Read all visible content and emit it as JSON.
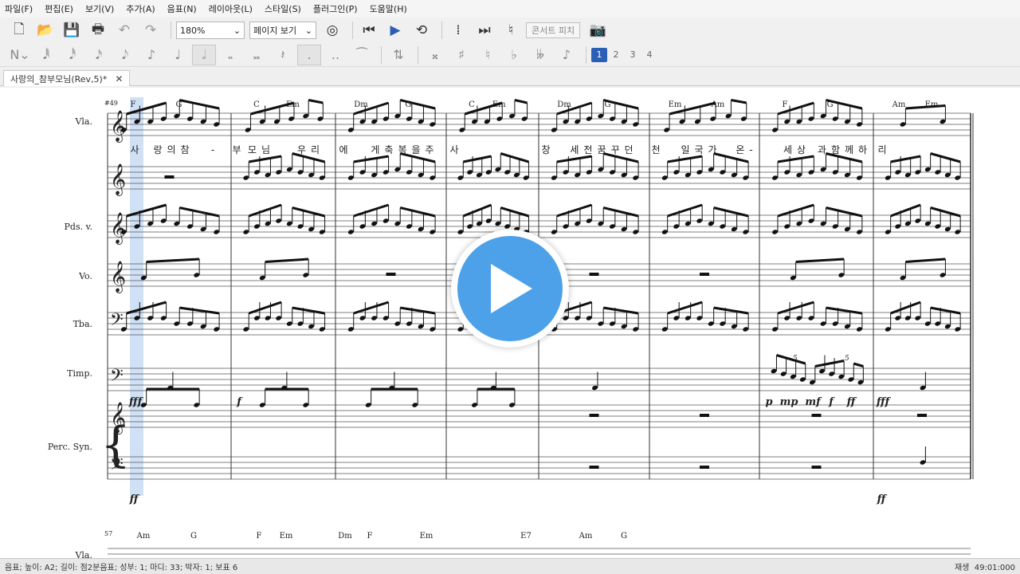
{
  "menu": [
    "파일(F)",
    "편집(E)",
    "보기(V)",
    "추가(A)",
    "음표(N)",
    "레이아웃(L)",
    "스타일(S)",
    "플러그인(P)",
    "도움말(H)"
  ],
  "toolbar": {
    "zoom": "180%",
    "view_mode": "페이지 보기",
    "concert_pitch": "콘서트 피치",
    "icons": [
      "new-score-icon",
      "open-icon",
      "save-icon",
      "print-icon",
      "undo-icon",
      "redo-icon",
      "midi-input-icon",
      "rewind-icon",
      "play-icon",
      "loop-icon",
      "play-repeats-icon",
      "pan-icon",
      "metronome-icon",
      "image-capture-icon"
    ]
  },
  "note_input": {
    "note_values": [
      "𝅘𝅥𝅱",
      "𝅘𝅥𝅰",
      "𝅘𝅥𝅯",
      "𝅘𝅥𝅮",
      "♪",
      "♩",
      "𝅗𝅥",
      "𝅝",
      "𝅜",
      "𝄽"
    ],
    "accidentals": [
      "𝄪",
      "♯",
      "♮",
      "♭",
      "𝄫"
    ],
    "voices": [
      "1",
      "2",
      "3",
      "4"
    ],
    "active_voice": "1"
  },
  "tab": {
    "title": "사랑의_참부모님(Rev,5)*"
  },
  "score": {
    "system1": {
      "measure_number": "49",
      "chords": [
        {
          "label": "F",
          "m": 0,
          "o": 0
        },
        {
          "label": "G",
          "m": 0,
          "o": 0.5
        },
        {
          "label": "C",
          "m": 1,
          "o": 0
        },
        {
          "label": "Em",
          "m": 1,
          "o": 0.5
        },
        {
          "label": "Dm",
          "m": 2,
          "o": 0
        },
        {
          "label": "G",
          "m": 2,
          "o": 0.6
        },
        {
          "label": "C",
          "m": 3,
          "o": 0
        },
        {
          "label": "Em",
          "m": 3,
          "o": 0.45
        },
        {
          "label": "Dm",
          "m": 4,
          "o": 0
        },
        {
          "label": "G",
          "m": 4,
          "o": 0.55
        },
        {
          "label": "Em",
          "m": 5,
          "o": 0
        },
        {
          "label": "Am",
          "m": 5,
          "o": 0.55
        },
        {
          "label": "F",
          "m": 6,
          "o": 0
        },
        {
          "label": "G",
          "m": 6,
          "o": 0.55
        },
        {
          "label": "Am",
          "m": 7,
          "o": 0
        },
        {
          "label": "Em",
          "m": 7,
          "o": 0.5
        }
      ],
      "lyrics": [
        "사",
        "랑의참",
        "-",
        "부",
        "모님",
        "우리",
        "에",
        "게축복을주",
        "사",
        "창",
        "세전꿈꾸던",
        "천",
        "일국가",
        "온-",
        "세상",
        "과함께하",
        "리"
      ],
      "instruments": [
        "Vla.",
        "",
        "Pds. v.",
        "Vo.",
        "Tba.",
        "Timp.",
        "Perc. Syn."
      ],
      "dynamics": [
        "fff",
        "f",
        "p",
        "mp",
        "mf",
        "f",
        "ff",
        "fff",
        "ff",
        "ff"
      ],
      "tuplet": "5"
    },
    "system2": {
      "measure_number": "57",
      "chords": [
        {
          "label": "Am",
          "m": 0,
          "o": 0
        },
        {
          "label": "G",
          "m": 0,
          "o": 0.6
        },
        {
          "label": "F",
          "m": 1,
          "o": 0
        },
        {
          "label": "Em",
          "m": 1,
          "o": 0.5
        },
        {
          "label": "Dm",
          "m": 2,
          "o": 0
        },
        {
          "label": "F",
          "m": 2,
          "o": 0.5
        },
        {
          "label": "Em",
          "m": 3,
          "o": 0
        },
        {
          "label": "E7",
          "m": 4,
          "o": 0
        },
        {
          "label": "Am",
          "m": 5,
          "o": 0
        },
        {
          "label": "G",
          "m": 5,
          "o": 0.6
        }
      ],
      "instrument": "Vla."
    }
  },
  "status": {
    "left": "음표; 높이: A2; 길이: 점2분음표; 성부: 1; 마디: 33; 박자: 1; 보표 6",
    "mode": "재생",
    "time": "49:01:000"
  },
  "colors": {
    "accent": "#2b5fb6",
    "play_overlay": "#4da1e8",
    "selection": "#a9c8ee"
  }
}
